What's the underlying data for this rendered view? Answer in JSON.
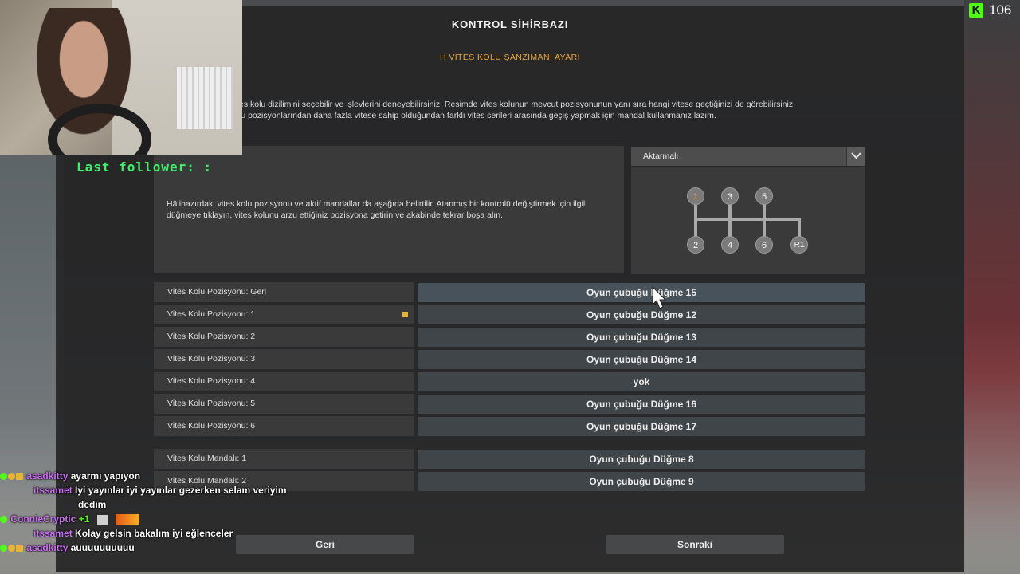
{
  "window": {
    "title": "KONTROL SİHİRBAZI",
    "subtitle": "H VİTES KOLU ŞANZIMANI AYARI",
    "description": [
      "es kolu dizilimini seçebilir ve işlevlerini deneyebilirsiniz. Resimde vites kolunun mevcut pozisyonunun yanı sıra hangi vitese geçtiğinizi de görebilirsiniz.",
      "lu pozisyonlarından daha fazla vitese sahip olduğundan farklı vites serileri arasında geçiş yapmak için mandal kullanmanız lazım."
    ],
    "info_text": "Hâlihazırdaki vites kolu pozisyonu ve aktif mandallar da aşağıda belirtilir. Atanmış bir kontrolü değiştirmek için ilgili düğmeye tıklayın, vites kolunu arzu ettiğiniz pozisyona getirin ve akabinde tekrar boşa alın."
  },
  "layout_select": {
    "value": "Aktarmalı"
  },
  "gear_pattern": {
    "top": [
      "1",
      "3",
      "5"
    ],
    "bottom": [
      "2",
      "4",
      "6",
      "R1"
    ],
    "active_gear": "1",
    "active_color": "#f0b44a"
  },
  "bindings": [
    {
      "label": "Vites Kolu Pozisyonu: Geri",
      "value": "Oyun çubuğu Düğme 15",
      "selected": true
    },
    {
      "label": "Vites Kolu Pozisyonu: 1",
      "value": "Oyun çubuğu Düğme 12",
      "indicator": true
    },
    {
      "label": "Vites Kolu Pozisyonu: 2",
      "value": "Oyun çubuğu Düğme 13"
    },
    {
      "label": "Vites Kolu Pozisyonu: 3",
      "value": "Oyun çubuğu Düğme 14"
    },
    {
      "label": "Vites Kolu Pozisyonu: 4",
      "value": "yok"
    },
    {
      "label": "Vites Kolu Pozisyonu: 5",
      "value": "Oyun çubuğu Düğme 16"
    },
    {
      "label": "Vites Kolu Pozisyonu: 6",
      "value": "Oyun çubuğu Düğme 17"
    }
  ],
  "splitters": [
    {
      "label": "Vites Kolu Mandalı: 1",
      "value": "Oyun çubuğu Düğme 8"
    },
    {
      "label": "Vites Kolu Mandalı: 2",
      "value": "Oyun çubuğu Düğme 9"
    }
  ],
  "nav": {
    "back": "Geri",
    "next": "Sonraki"
  },
  "stream_overlay": {
    "last_follower": "Last follower: :",
    "viewer_count": "106",
    "platform_logo": "K",
    "platform_color": "#53fc18"
  },
  "chat": [
    {
      "user": "asadkitty",
      "user_color": "#c86ff0",
      "message": "ayarmı yapıyon"
    },
    {
      "user": "itssamet",
      "user_color": "#c86ff0",
      "message": "İyi yayınlar iyi yayınlar gezerken selam veriyim"
    },
    {
      "user": "",
      "user_color": "#ffffff",
      "message": "dedim"
    },
    {
      "user": "ConnieCryptic",
      "user_color": "#c86ff0",
      "message": "+1"
    },
    {
      "user": "itssamet",
      "user_color": "#c86ff0",
      "message": "Kolay gelsin bakalım iyi eğlenceler"
    },
    {
      "user": "asadkitty",
      "user_color": "#c86ff0",
      "message": "auuuuuuuuuu"
    }
  ]
}
